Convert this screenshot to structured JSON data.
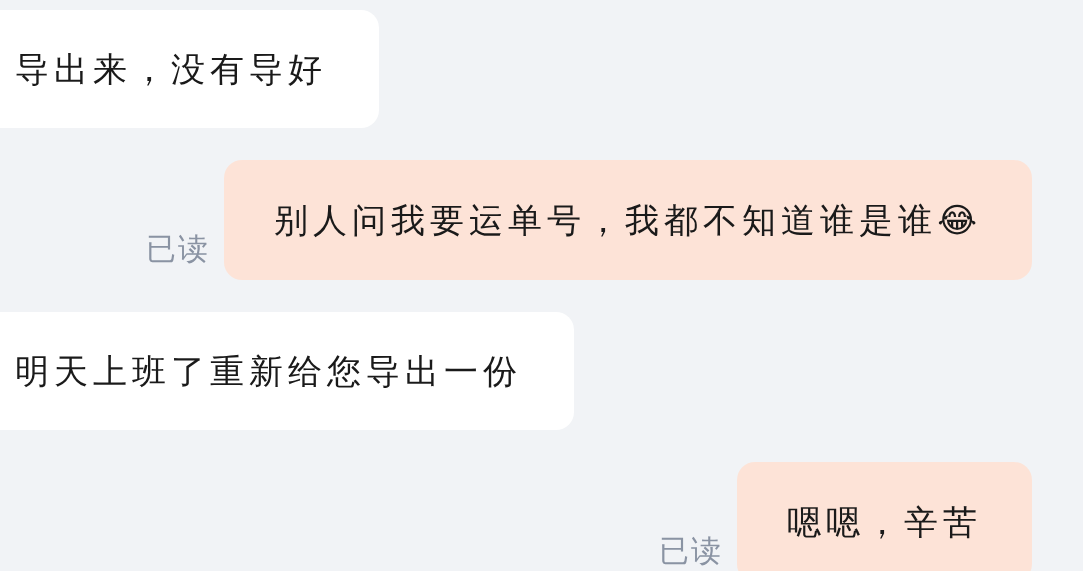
{
  "messages": [
    {
      "kind": "incoming",
      "text": "导出来，没有导好"
    },
    {
      "kind": "outgoing",
      "text": "别人问我要运单号，我都不知道谁是谁😂",
      "status": "已读"
    },
    {
      "kind": "incoming",
      "text": "明天上班了重新给您导出一份"
    },
    {
      "kind": "outgoing",
      "text": "嗯嗯，辛苦",
      "status": "已读"
    }
  ]
}
